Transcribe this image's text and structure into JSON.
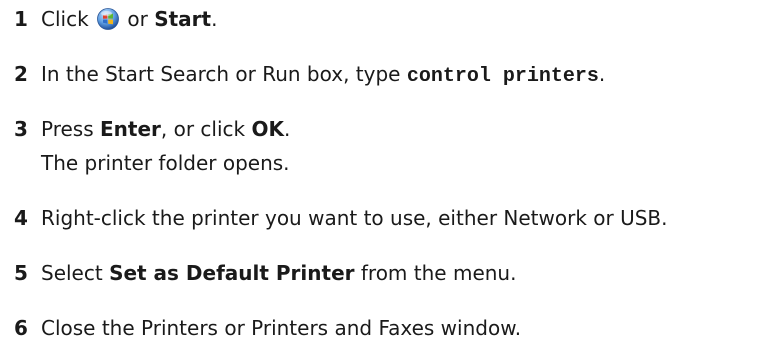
{
  "steps": [
    {
      "number": "1",
      "pre": "Click",
      "icon": "windows-start-orb-icon",
      "mid": "or",
      "bold": "Start",
      "post": "."
    },
    {
      "number": "2",
      "pre": "In the Start Search or Run box, type",
      "code": "control printers",
      "post": "."
    },
    {
      "number": "3",
      "pre": "Press",
      "bold1": "Enter",
      "mid": ", or click",
      "bold2": "OK",
      "post": ".",
      "result": "The printer folder opens."
    },
    {
      "number": "4",
      "text": "Right-click the printer you want to use, either Network or USB."
    },
    {
      "number": "5",
      "pre": "Select",
      "bold": "Set as Default Printer",
      "post": "from the menu."
    },
    {
      "number": "6",
      "text": "Close the Printers or Printers and Faxes window."
    }
  ],
  "colors": {
    "text": "#1a1a1a",
    "orb_blue": "#2f6fc9",
    "orb_red": "#e0402a",
    "orb_green": "#5cb531",
    "orb_yellow": "#f2b51c"
  }
}
